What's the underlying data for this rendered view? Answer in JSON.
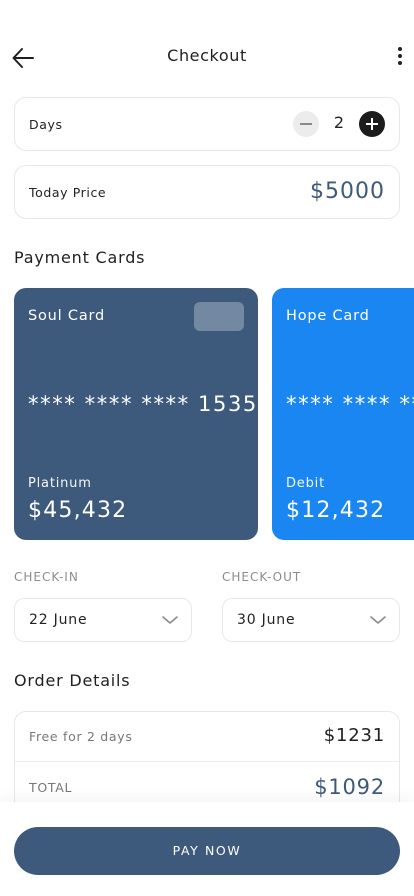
{
  "header": {
    "title": "Checkout",
    "back_icon": "arrow-left-icon",
    "more_icon": "more-vertical-icon"
  },
  "days": {
    "label": "Days",
    "value": "2"
  },
  "today_price": {
    "label": "Today Price",
    "value": "$5000"
  },
  "payment_cards": {
    "title": "Payment Cards",
    "cards": [
      {
        "name": "Soul Card",
        "number": "**** **** **** 1535",
        "type": "Platinum",
        "balance": "$45,432",
        "color": "#3d5a7d"
      },
      {
        "name": "Hope Card",
        "number": "**** **** **** ****",
        "type": "Debit",
        "balance": "$12,432",
        "color": "#1a86f2"
      }
    ]
  },
  "check_in": {
    "label": "CHECK-IN",
    "value": "22 June"
  },
  "check_out": {
    "label": "CHECK-OUT",
    "value": "30 June"
  },
  "order_details": {
    "title": "Order Details",
    "rows": [
      {
        "label": "Free for 2 days",
        "value": "$1231"
      },
      {
        "label": "TOTAL",
        "value": "$1092"
      }
    ]
  },
  "pay_button": {
    "label": "PAY NOW"
  },
  "colors": {
    "accent": "#3d5a7c",
    "card_blue": "#1a86f2"
  }
}
